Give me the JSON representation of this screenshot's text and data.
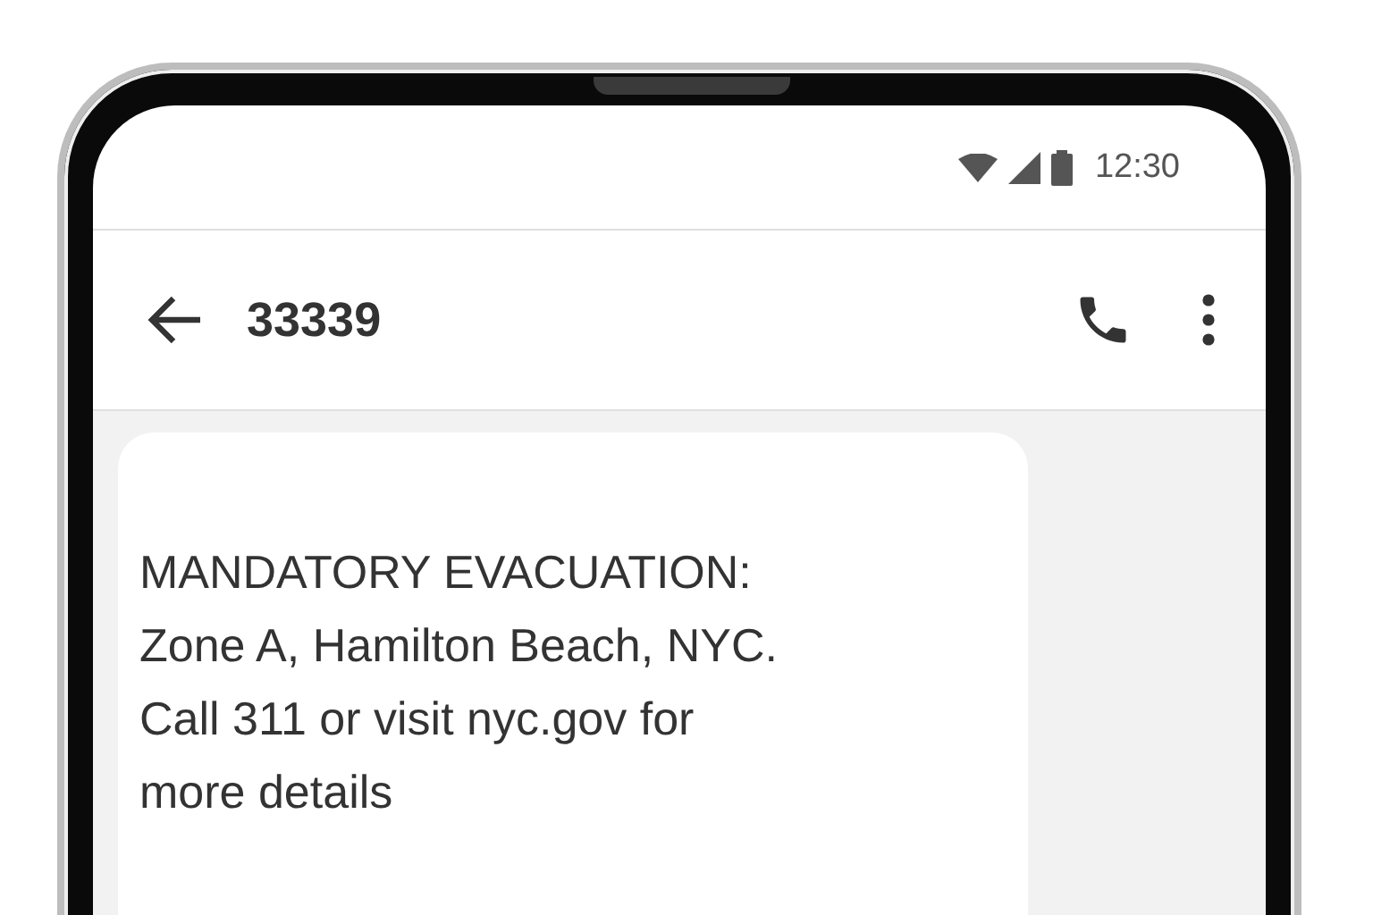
{
  "status_bar": {
    "time": "12:30"
  },
  "app_bar": {
    "title": "33339"
  },
  "messages": [
    {
      "lines": [
        "MANDATORY EVACUATION:",
        "Zone A, Hamilton Beach, NYC.",
        "Call 311 or visit nyc.gov for",
        "more details"
      ]
    }
  ]
}
